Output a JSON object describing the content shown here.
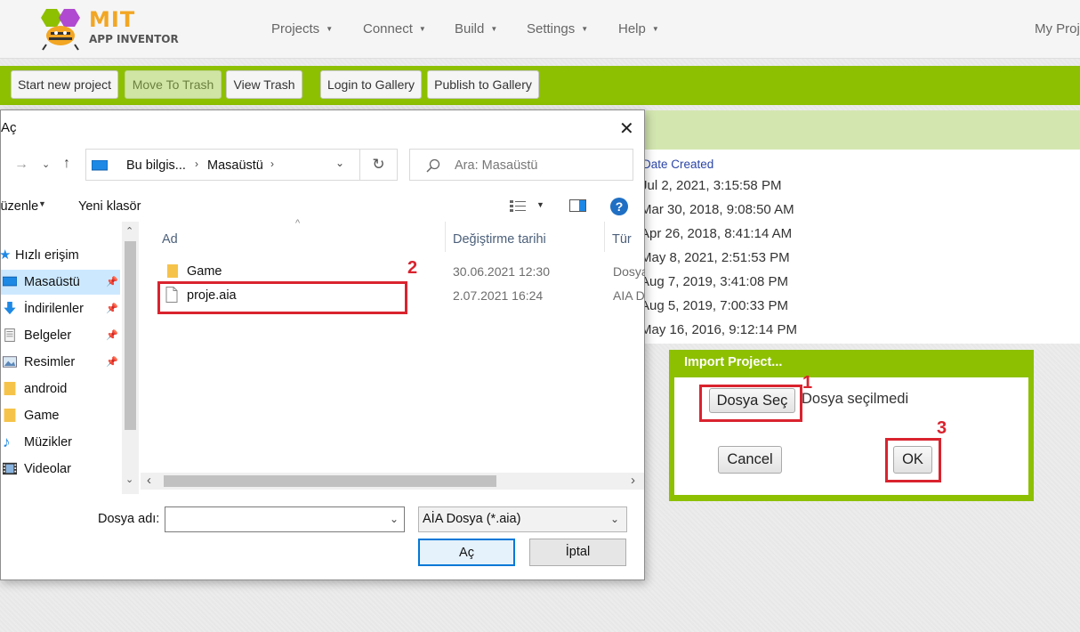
{
  "header": {
    "logo": {
      "title": "MIT",
      "subtitle": "APP INVENTOR"
    },
    "nav": [
      "Projects",
      "Connect",
      "Build",
      "Settings",
      "Help"
    ],
    "user": "My Proj"
  },
  "toolbar": {
    "buttons": [
      "Start new project",
      "Move To Trash",
      "View Trash",
      "Login to Gallery",
      "Publish to Gallery"
    ]
  },
  "project_list": {
    "date_header": "Date Created",
    "dates": [
      "Jul 2, 2021, 3:15:58 PM",
      "Mar 30, 2018, 9:08:50 AM",
      "Apr 26, 2018, 8:41:14 AM",
      "May 8, 2021, 2:51:53 PM",
      "Aug 7, 2019, 3:41:08 PM",
      "Aug 5, 2019, 7:00:33 PM",
      "May 16, 2016, 9:12:14 PM"
    ]
  },
  "import_dialog": {
    "title": "Import Project...",
    "choose_button": "Dosya Seç",
    "no_file_text": "Dosya seçilmedi",
    "cancel": "Cancel",
    "ok": "OK",
    "markers": [
      "1",
      "2",
      "3"
    ]
  },
  "file_dialog": {
    "title": "Aç",
    "address": [
      "Bu bilgis...",
      "Masaüstü"
    ],
    "search_placeholder": "Ara: Masaüstü",
    "organize": "Düzenle",
    "new_folder": "Yeni klasör",
    "sidebar": [
      {
        "label": "Hızlı erişim",
        "icon": "star-icon"
      },
      {
        "label": "Masaüstü",
        "icon": "desktop-icon",
        "pinned": true,
        "selected": true
      },
      {
        "label": "İndirilenler",
        "icon": "download-icon",
        "pinned": true
      },
      {
        "label": "Belgeler",
        "icon": "document-icon",
        "pinned": true
      },
      {
        "label": "Resimler",
        "icon": "pictures-icon",
        "pinned": true
      },
      {
        "label": "android",
        "icon": "folder-icon"
      },
      {
        "label": "Game",
        "icon": "folder-icon"
      },
      {
        "label": "Müzikler",
        "icon": "music-icon"
      },
      {
        "label": "Videolar",
        "icon": "video-icon"
      }
    ],
    "columns": [
      "Ad",
      "Değiştirme tarihi",
      "Tür"
    ],
    "files": [
      {
        "name": "Game",
        "date": "30.06.2021 12:30",
        "type": "Dosya",
        "icon": "folder-icon"
      },
      {
        "name": "proje.aia",
        "date": "2.07.2021 16:24",
        "type": "AIA D",
        "icon": "file-icon"
      }
    ],
    "filename_label": "Dosya adı:",
    "filename_value": "",
    "filetype": "AİA Dosya (*.aia)",
    "open_button": "Aç",
    "cancel_button": "İptal"
  },
  "colors": {
    "brand_green": "#8dc000",
    "annotation_red": "#d9232e",
    "logo_orange": "#f2a623"
  }
}
